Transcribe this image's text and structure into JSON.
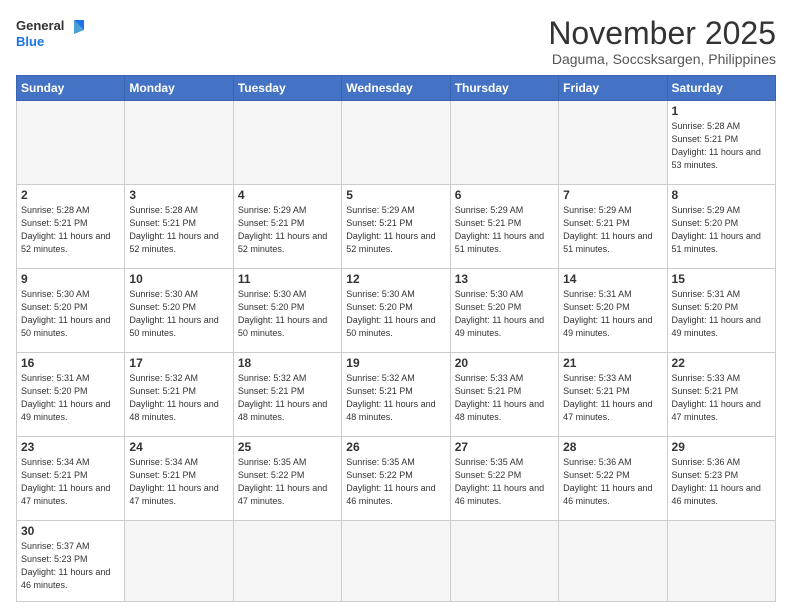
{
  "logo": {
    "line1": "General",
    "line2": "Blue"
  },
  "title": "November 2025",
  "location": "Daguma, Soccsksargen, Philippines",
  "weekdays": [
    "Sunday",
    "Monday",
    "Tuesday",
    "Wednesday",
    "Thursday",
    "Friday",
    "Saturday"
  ],
  "weeks": [
    [
      {
        "day": "",
        "empty": true
      },
      {
        "day": "",
        "empty": true
      },
      {
        "day": "",
        "empty": true
      },
      {
        "day": "",
        "empty": true
      },
      {
        "day": "",
        "empty": true
      },
      {
        "day": "",
        "empty": true
      },
      {
        "day": "1",
        "sunrise": "5:28 AM",
        "sunset": "5:21 PM",
        "daylight": "11 hours and 53 minutes."
      }
    ],
    [
      {
        "day": "2",
        "sunrise": "5:28 AM",
        "sunset": "5:21 PM",
        "daylight": "11 hours and 52 minutes."
      },
      {
        "day": "3",
        "sunrise": "5:28 AM",
        "sunset": "5:21 PM",
        "daylight": "11 hours and 52 minutes."
      },
      {
        "day": "4",
        "sunrise": "5:29 AM",
        "sunset": "5:21 PM",
        "daylight": "11 hours and 52 minutes."
      },
      {
        "day": "5",
        "sunrise": "5:29 AM",
        "sunset": "5:21 PM",
        "daylight": "11 hours and 52 minutes."
      },
      {
        "day": "6",
        "sunrise": "5:29 AM",
        "sunset": "5:21 PM",
        "daylight": "11 hours and 51 minutes."
      },
      {
        "day": "7",
        "sunrise": "5:29 AM",
        "sunset": "5:21 PM",
        "daylight": "11 hours and 51 minutes."
      },
      {
        "day": "8",
        "sunrise": "5:29 AM",
        "sunset": "5:20 PM",
        "daylight": "11 hours and 51 minutes."
      }
    ],
    [
      {
        "day": "9",
        "sunrise": "5:30 AM",
        "sunset": "5:20 PM",
        "daylight": "11 hours and 50 minutes."
      },
      {
        "day": "10",
        "sunrise": "5:30 AM",
        "sunset": "5:20 PM",
        "daylight": "11 hours and 50 minutes."
      },
      {
        "day": "11",
        "sunrise": "5:30 AM",
        "sunset": "5:20 PM",
        "daylight": "11 hours and 50 minutes."
      },
      {
        "day": "12",
        "sunrise": "5:30 AM",
        "sunset": "5:20 PM",
        "daylight": "11 hours and 50 minutes."
      },
      {
        "day": "13",
        "sunrise": "5:30 AM",
        "sunset": "5:20 PM",
        "daylight": "11 hours and 49 minutes."
      },
      {
        "day": "14",
        "sunrise": "5:31 AM",
        "sunset": "5:20 PM",
        "daylight": "11 hours and 49 minutes."
      },
      {
        "day": "15",
        "sunrise": "5:31 AM",
        "sunset": "5:20 PM",
        "daylight": "11 hours and 49 minutes."
      }
    ],
    [
      {
        "day": "16",
        "sunrise": "5:31 AM",
        "sunset": "5:20 PM",
        "daylight": "11 hours and 49 minutes."
      },
      {
        "day": "17",
        "sunrise": "5:32 AM",
        "sunset": "5:21 PM",
        "daylight": "11 hours and 48 minutes."
      },
      {
        "day": "18",
        "sunrise": "5:32 AM",
        "sunset": "5:21 PM",
        "daylight": "11 hours and 48 minutes."
      },
      {
        "day": "19",
        "sunrise": "5:32 AM",
        "sunset": "5:21 PM",
        "daylight": "11 hours and 48 minutes."
      },
      {
        "day": "20",
        "sunrise": "5:33 AM",
        "sunset": "5:21 PM",
        "daylight": "11 hours and 48 minutes."
      },
      {
        "day": "21",
        "sunrise": "5:33 AM",
        "sunset": "5:21 PM",
        "daylight": "11 hours and 47 minutes."
      },
      {
        "day": "22",
        "sunrise": "5:33 AM",
        "sunset": "5:21 PM",
        "daylight": "11 hours and 47 minutes."
      }
    ],
    [
      {
        "day": "23",
        "sunrise": "5:34 AM",
        "sunset": "5:21 PM",
        "daylight": "11 hours and 47 minutes."
      },
      {
        "day": "24",
        "sunrise": "5:34 AM",
        "sunset": "5:21 PM",
        "daylight": "11 hours and 47 minutes."
      },
      {
        "day": "25",
        "sunrise": "5:35 AM",
        "sunset": "5:22 PM",
        "daylight": "11 hours and 47 minutes."
      },
      {
        "day": "26",
        "sunrise": "5:35 AM",
        "sunset": "5:22 PM",
        "daylight": "11 hours and 46 minutes."
      },
      {
        "day": "27",
        "sunrise": "5:35 AM",
        "sunset": "5:22 PM",
        "daylight": "11 hours and 46 minutes."
      },
      {
        "day": "28",
        "sunrise": "5:36 AM",
        "sunset": "5:22 PM",
        "daylight": "11 hours and 46 minutes."
      },
      {
        "day": "29",
        "sunrise": "5:36 AM",
        "sunset": "5:23 PM",
        "daylight": "11 hours and 46 minutes."
      }
    ],
    [
      {
        "day": "30",
        "sunrise": "5:37 AM",
        "sunset": "5:23 PM",
        "daylight": "11 hours and 46 minutes."
      },
      {
        "day": "",
        "empty": true
      },
      {
        "day": "",
        "empty": true
      },
      {
        "day": "",
        "empty": true
      },
      {
        "day": "",
        "empty": true
      },
      {
        "day": "",
        "empty": true
      },
      {
        "day": "",
        "empty": true
      }
    ]
  ],
  "labels": {
    "sunrise": "Sunrise:",
    "sunset": "Sunset:",
    "daylight": "Daylight:"
  }
}
